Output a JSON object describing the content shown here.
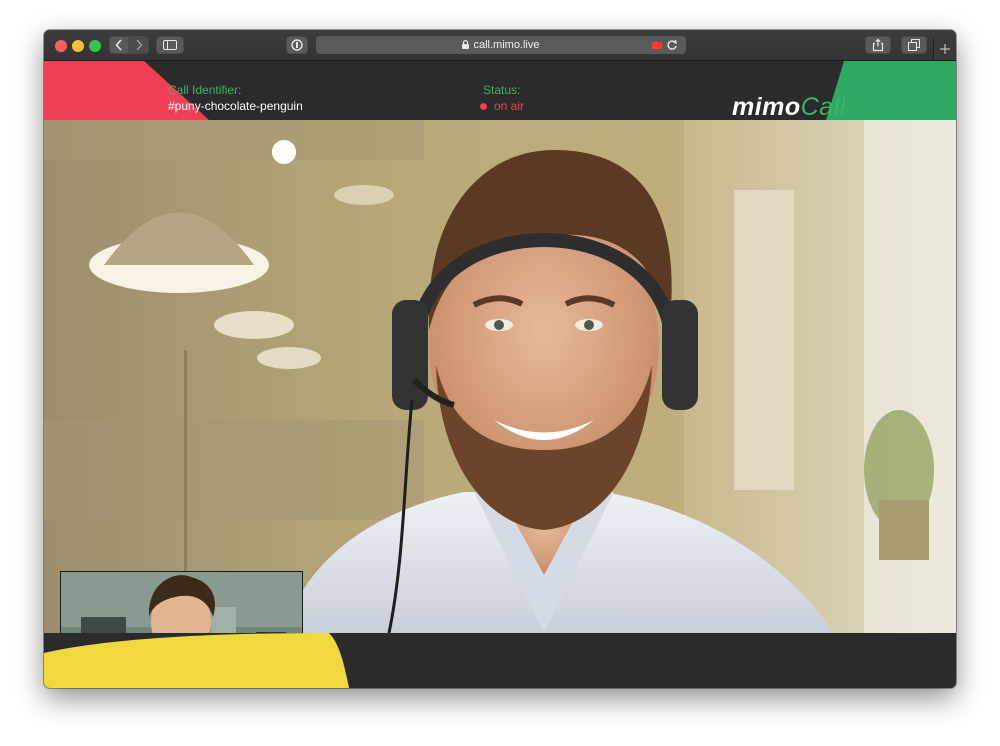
{
  "browser": {
    "url": "call.mimo.live",
    "icons": [
      "back-icon",
      "forward-icon",
      "sidebar-icon",
      "privacy-icon",
      "lock-icon",
      "recording-icon",
      "reload-icon",
      "share-icon",
      "tabs-icon",
      "new-tab-icon"
    ]
  },
  "call": {
    "identifier_label": "Call Identifier:",
    "identifier_value": "#puny-chocolate-penguin",
    "status_label": "Status:",
    "status_value": "on air"
  },
  "logo": {
    "part_a": "mimo",
    "part_b": "Call"
  },
  "controls": {
    "icons": [
      "microphone-icon",
      "camera-icon",
      "participants-icon",
      "picture-in-picture-icon",
      "settings-icon"
    ]
  },
  "colors": {
    "accent_red": "#ef3f56",
    "accent_green": "#3fb368",
    "accent_yellow": "#f0d83e",
    "background_dark": "#2b2b2b"
  }
}
